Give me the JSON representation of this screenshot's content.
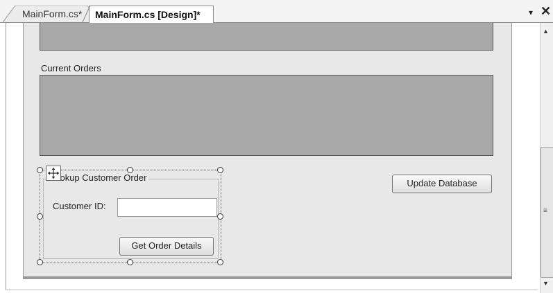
{
  "tabs": [
    {
      "label": "MainForm.cs*",
      "active": false
    },
    {
      "label": "MainForm.cs [Design]*",
      "active": true
    }
  ],
  "tab_controls": {
    "menu_icon": "dropdown-arrow-icon",
    "menu_glyph": "▾",
    "close_icon": "close-icon",
    "close_glyph": "✕"
  },
  "form": {
    "current_orders_label": "Current Orders",
    "groupbox": {
      "title": "Lookup Customer Order",
      "customer_id_label": "Customer ID:",
      "customer_id_value": "",
      "get_order_details_button": "Get Order Details"
    },
    "update_database_button": "Update Database"
  },
  "scrollbar": {
    "up_glyph": "▲",
    "down_glyph": "▼",
    "grip_glyph": "≡"
  },
  "colors": {
    "grid_fill": "#a8a8a8",
    "form_background": "#e8e8e8",
    "tab_strip": "#f4f4f4"
  }
}
